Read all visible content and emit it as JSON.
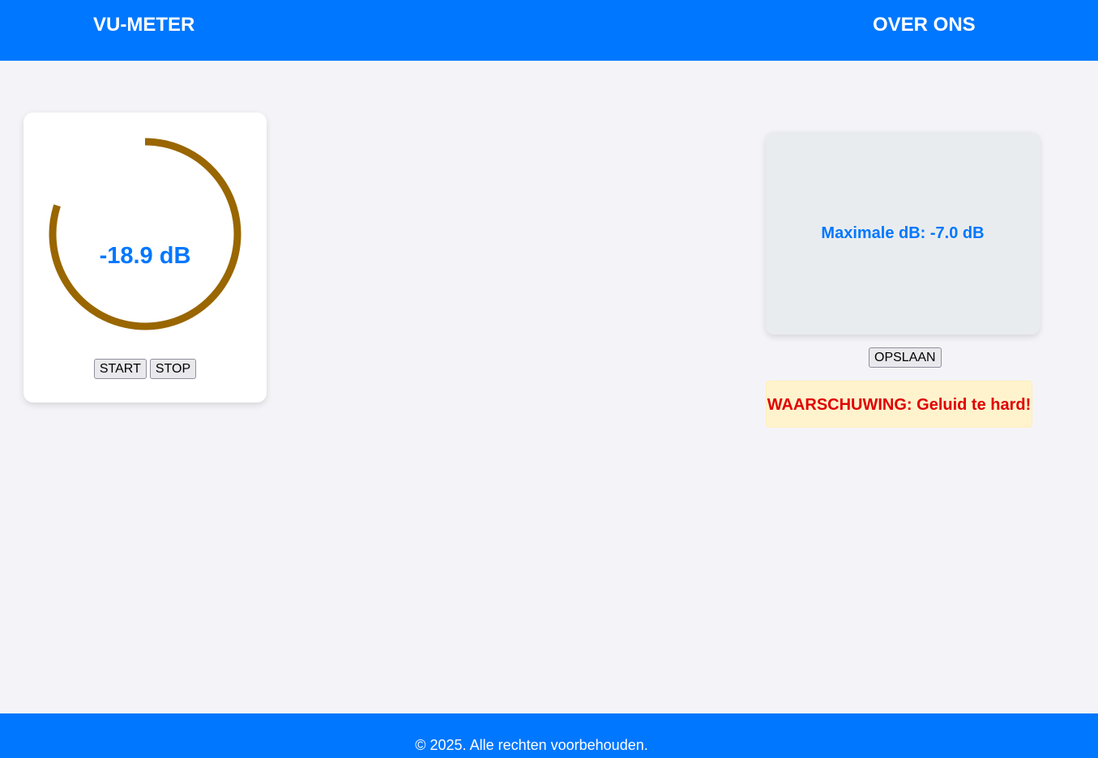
{
  "nav": {
    "vu_meter_label": "VU-METER",
    "over_ons_label": "OVER ONS"
  },
  "meter": {
    "value_text": "-18.9 dB",
    "level_fraction": 0.8,
    "arc_color": "#996600",
    "start_label": "START",
    "stop_label": "STOP"
  },
  "max_panel": {
    "text": "Maximale dB: -7.0 dB",
    "save_label": "OPSLAAN"
  },
  "warning": {
    "text": "WAARSCHUWING: Geluid te hard!"
  },
  "footer": {
    "text": "© 2025. Alle rechten voorbehouden."
  },
  "colors": {
    "accent": "#0077ff",
    "page_bg": "#f4f4f8",
    "warning_text": "#e00000",
    "warning_bg": "#fff3cd"
  }
}
